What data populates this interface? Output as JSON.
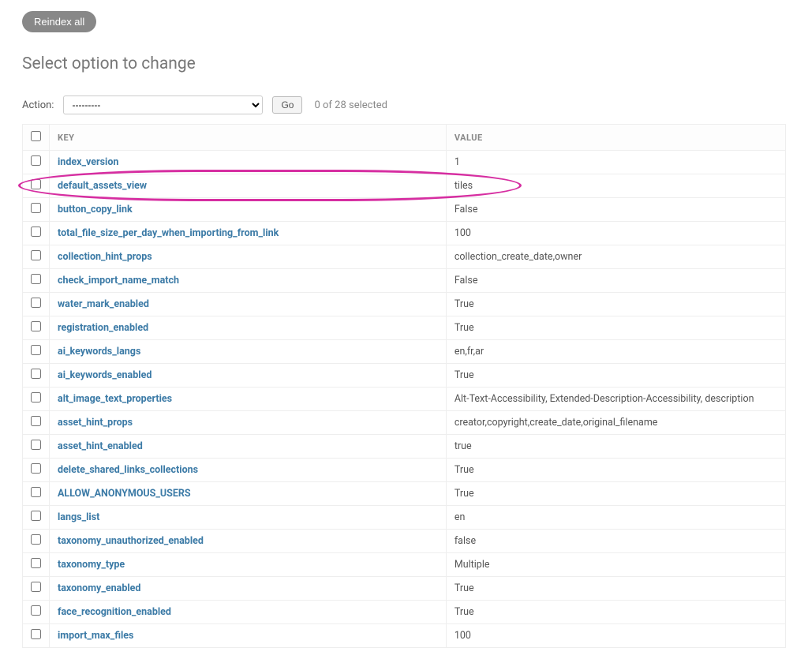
{
  "reindex_label": "Reindex all",
  "page_title": "Select option to change",
  "action_label": "Action:",
  "action_select_placeholder": "---------",
  "go_label": "Go",
  "selection_count": "0 of 28 selected",
  "highlighted_key": "default_assets_view",
  "columns": {
    "key": "KEY",
    "value": "VALUE"
  },
  "rows": [
    {
      "key": "index_version",
      "value": "1"
    },
    {
      "key": "default_assets_view",
      "value": "tiles"
    },
    {
      "key": "button_copy_link",
      "value": "False"
    },
    {
      "key": "total_file_size_per_day_when_importing_from_link",
      "value": "100"
    },
    {
      "key": "collection_hint_props",
      "value": "collection_create_date,owner"
    },
    {
      "key": "check_import_name_match",
      "value": "False"
    },
    {
      "key": "water_mark_enabled",
      "value": "True"
    },
    {
      "key": "registration_enabled",
      "value": "True"
    },
    {
      "key": "ai_keywords_langs",
      "value": "en,fr,ar"
    },
    {
      "key": "ai_keywords_enabled",
      "value": "True"
    },
    {
      "key": "alt_image_text_properties",
      "value": "Alt-Text-Accessibility, Extended-Description-Accessibility, description"
    },
    {
      "key": "asset_hint_props",
      "value": "creator,copyright,create_date,original_filename"
    },
    {
      "key": "asset_hint_enabled",
      "value": "true"
    },
    {
      "key": "delete_shared_links_collections",
      "value": "True"
    },
    {
      "key": "ALLOW_ANONYMOUS_USERS",
      "value": "True"
    },
    {
      "key": "langs_list",
      "value": "en"
    },
    {
      "key": "taxonomy_unauthorized_enabled",
      "value": "false"
    },
    {
      "key": "taxonomy_type",
      "value": "Multiple"
    },
    {
      "key": "taxonomy_enabled",
      "value": "True"
    },
    {
      "key": "face_recognition_enabled",
      "value": "True"
    },
    {
      "key": "import_max_files",
      "value": "100"
    }
  ]
}
